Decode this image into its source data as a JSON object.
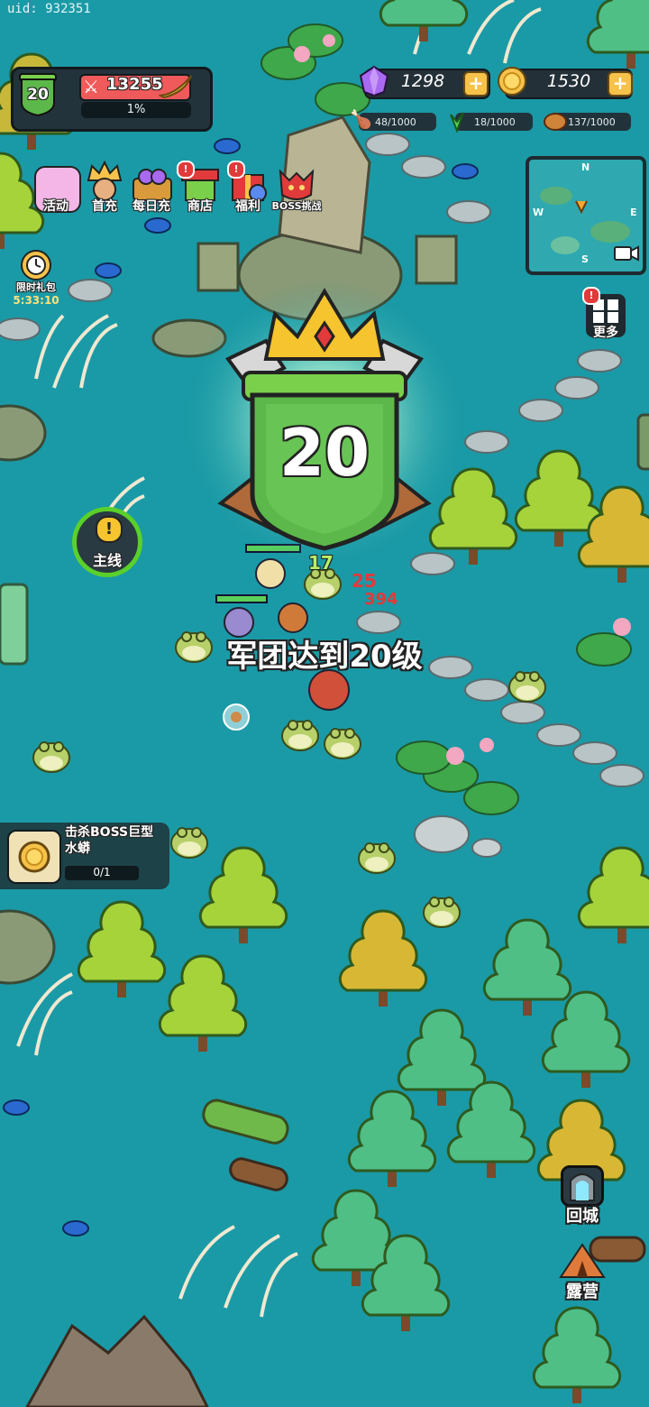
{
  "uid_text": "uid: 932351",
  "player": {
    "level": "20",
    "power": "13255",
    "xp_percent": "1%"
  },
  "currencies": {
    "gems": "1298",
    "gold": "1530"
  },
  "resources": {
    "meat": "48/1000",
    "herb": "18/1000",
    "wood": "137/1000"
  },
  "top_menu": {
    "activity": "活动",
    "first_charge": "首充",
    "daily_charge": "每日充",
    "shop": "商店",
    "welfare": "福利",
    "boss_challenge": "BOSS挑战"
  },
  "limited_pack": {
    "label": "限时礼包",
    "timer": "5:33:10"
  },
  "minimap": {
    "n": "N",
    "w": "W",
    "e": "E",
    "s": "S"
  },
  "more_label": "更多",
  "main_quest_label": "主线",
  "levelup": {
    "badge_level": "20",
    "message": "军团达到20级"
  },
  "damage_numbers": [
    "17",
    "25",
    "394"
  ],
  "quest": {
    "title": "击杀BOSS巨型水蟒",
    "progress": "0/1"
  },
  "return_city_label": "回城",
  "camp_label": "露营",
  "colors": {
    "water": "#1a9aa6",
    "badge_green": "#5cb84a",
    "gold": "#f6c24a",
    "gem": "#a86af0"
  }
}
